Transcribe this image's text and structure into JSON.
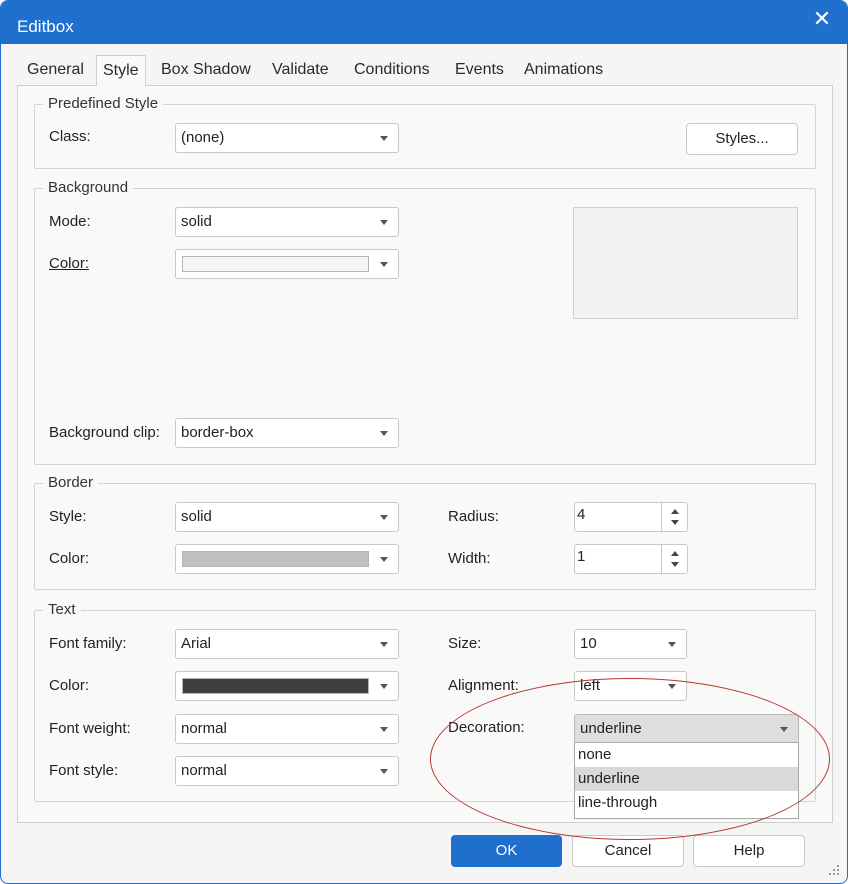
{
  "window": {
    "title": "Editbox"
  },
  "tabs": [
    "General",
    "Style",
    "Box Shadow",
    "Validate",
    "Conditions",
    "Events",
    "Animations"
  ],
  "active_tab": "Style",
  "predefined_style": {
    "group_label": "Predefined Style",
    "class_label": "Class:",
    "class_value": "(none)",
    "styles_button": "Styles..."
  },
  "background": {
    "group_label": "Background",
    "mode_label": "Mode:",
    "mode_value": "solid",
    "color_label": "Color:",
    "color_value": "#f5f5f5",
    "clip_label": "Background clip:",
    "clip_value": "border-box"
  },
  "border": {
    "group_label": "Border",
    "style_label": "Style:",
    "style_value": "solid",
    "color_label": "Color:",
    "color_value": "#c0c0c0",
    "radius_label": "Radius:",
    "radius_value": "4",
    "width_label": "Width:",
    "width_value": "1"
  },
  "text": {
    "group_label": "Text",
    "font_family_label": "Font family:",
    "font_family_value": "Arial",
    "color_label": "Color:",
    "color_value": "#3d3d3d",
    "font_weight_label": "Font weight:",
    "font_weight_value": "normal",
    "font_style_label": "Font style:",
    "font_style_value": "normal",
    "size_label": "Size:",
    "size_value": "10",
    "alignment_label": "Alignment:",
    "alignment_value": "left",
    "decoration_label": "Decoration:",
    "decoration_value": "underline",
    "decoration_options": [
      "none",
      "underline",
      "line-through"
    ]
  },
  "footer": {
    "ok": "OK",
    "cancel": "Cancel",
    "help": "Help"
  },
  "colors": {
    "accent": "#1f6fcf",
    "annotation": "#b23a2e"
  }
}
